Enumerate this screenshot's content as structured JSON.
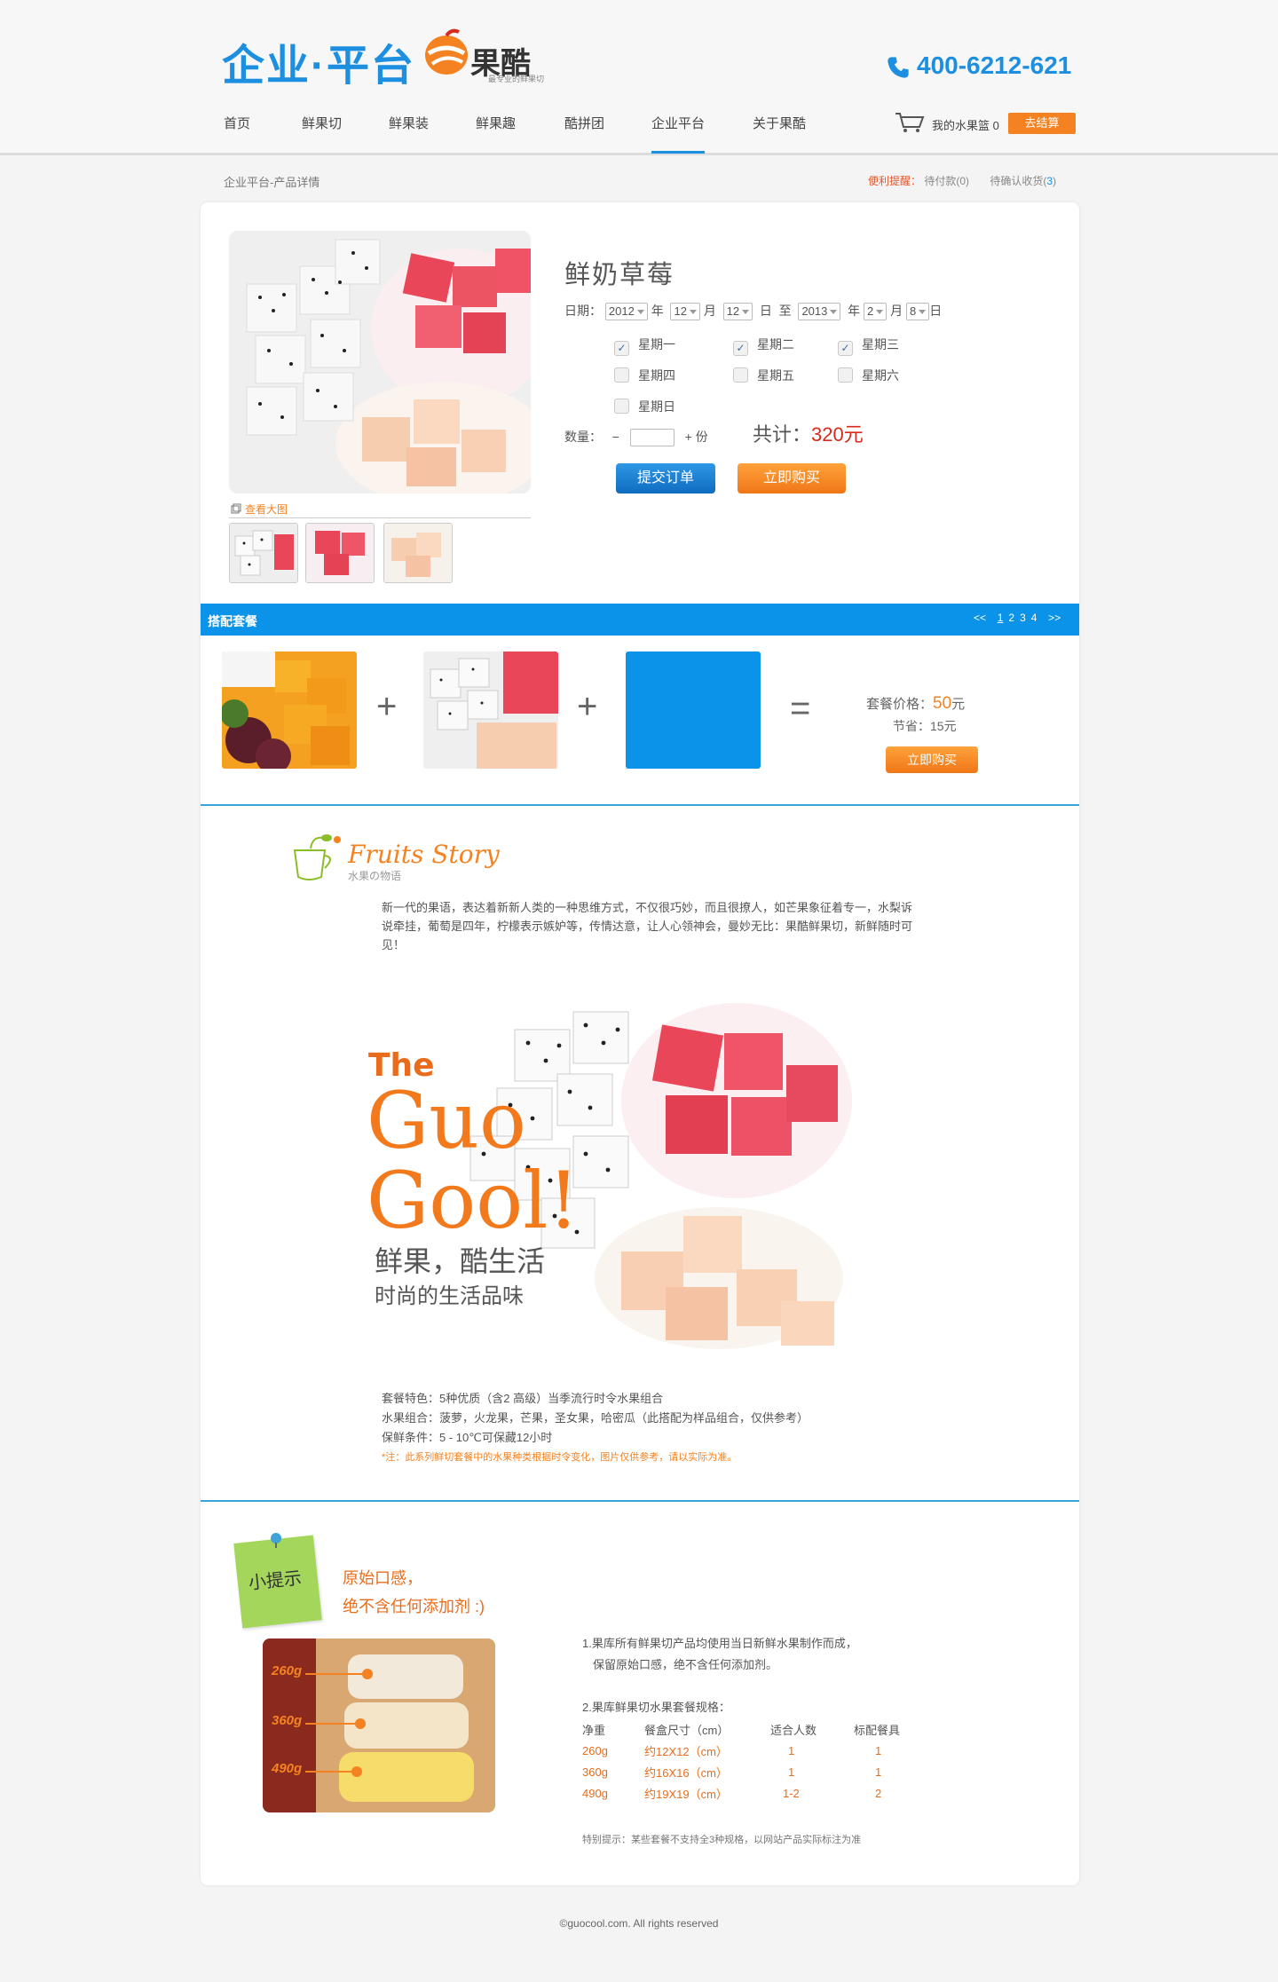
{
  "header": {
    "logo_left": "企业",
    "logo_dot": "·",
    "logo_right": "平台",
    "brand_name": "果酷",
    "brand_sub": "最专业的鲜果切",
    "phone": "400-6212-621",
    "nav": [
      "首页",
      "鲜果切",
      "鲜果装",
      "鲜果趣",
      "酷拼团",
      "企业平台",
      "关于果酷"
    ],
    "cart_label": "我的水果篮 0",
    "checkout_label": "去结算"
  },
  "breadcrumb": "企业平台-产品详情",
  "tips": {
    "label": "便利提醒：",
    "pending_pay": "待付款(0)",
    "pending_confirm_prefix": "待确认收货(",
    "pending_confirm_count": "3",
    "pending_confirm_suffix": ")"
  },
  "product": {
    "title": "鲜奶草莓",
    "view_large": "查看大图",
    "date_label": "日期：",
    "from": {
      "year": "2012",
      "year_unit": "年",
      "month": "12",
      "month_unit": "月",
      "day": "12",
      "day_unit": "日"
    },
    "to_label": "至",
    "to": {
      "year": "2013",
      "year_unit": "年",
      "month": "2",
      "month_unit": "月",
      "day": "8",
      "day_unit": "日"
    },
    "weekdays": [
      {
        "label": "星期一",
        "checked": true
      },
      {
        "label": "星期二",
        "checked": true
      },
      {
        "label": "星期三",
        "checked": true
      },
      {
        "label": "星期四",
        "checked": false
      },
      {
        "label": "星期五",
        "checked": false
      },
      {
        "label": "星期六",
        "checked": false
      },
      {
        "label": "星期日",
        "checked": false
      }
    ],
    "qty_label": "数量：",
    "minus": "−",
    "plus": "+",
    "unit": "份",
    "total_label": "共计：",
    "total_value": "320元",
    "submit_label": "提交订单",
    "buy_label": "立即购买"
  },
  "package": {
    "title": "搭配套餐",
    "pager_prev": "<<",
    "pages": [
      "1",
      "2",
      "3",
      "4"
    ],
    "pager_next": ">>",
    "plus": "+",
    "equals": "=",
    "price_label": "套餐价格：",
    "price_value": "50",
    "price_unit": "元",
    "save_label": "节省：",
    "save_value": "15元",
    "buy_label": "立即购买"
  },
  "story": {
    "title": "Fruits Story",
    "subtitle": "水果の物语",
    "text": "新一代的果语，表达着新新人类的一种思维方式，不仅很巧妙，而且很撩人，如芒果象征着专一，水梨诉说牵挂，葡萄是四年，柠檬表示嫉妒等，传情达意，让人心领神会，曼妙无比：果酷鲜果切，新鲜随时可见！",
    "hero_the": "The",
    "hero_guo": "Guo",
    "hero_gool": "Gool!",
    "slogan1": "鲜果，酷生活",
    "slogan2": "时尚的生活品味",
    "features": [
      "套餐特色：5种优质（含2 高级）当季流行时令水果组合",
      "水果组合：菠萝，火龙果，芒果，圣女果，哈密瓜（此搭配为样品组合，仅供参考）",
      "保鲜条件：5 - 10℃可保藏12小时"
    ],
    "note": "*注：此系列鲜切套餐中的水果种类根据时令变化，图片仅供参考，请以实际为准。"
  },
  "tipsSection": {
    "note_label": "小提示",
    "line1": "原始口感，",
    "line2": "绝不含任何添加剂 :)",
    "sizes_in_image": [
      "260g",
      "360g",
      "490g"
    ],
    "info1": "1.果库所有鲜果切产品均使用当日新鲜水果制作而成，",
    "info1b": "保留原始口感，绝不含任何添加剂。",
    "info2": "2.果库鲜果切水果套餐规格：",
    "headers": [
      "净重",
      "餐盒尺寸（cm）",
      "适合人数",
      "标配餐具"
    ],
    "rows": [
      [
        "260g",
        "约12X12（cm）",
        "1",
        "1"
      ],
      [
        "360g",
        "约16X16（cm）",
        "1",
        "1"
      ],
      [
        "490g",
        "约19X19（cm）",
        "1-2",
        "2"
      ]
    ],
    "special": "特别提示：某些套餐不支持全3种规格，以网站产品实际标注为准"
  },
  "footer": "©guocool.com. All rights reserved"
}
